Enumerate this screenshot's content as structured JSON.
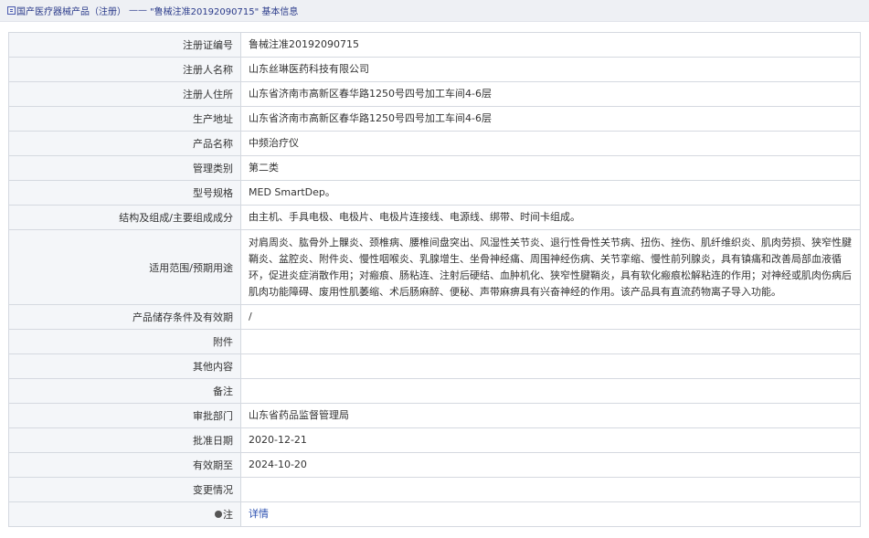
{
  "breadcrumb": {
    "root": "国产医疗器械产品（注册）",
    "separator": "——",
    "current": "\"鲁械注准20192090715\" 基本信息"
  },
  "rows": [
    {
      "label": "注册证编号",
      "value": "鲁械注准20192090715"
    },
    {
      "label": "注册人名称",
      "value": "山东丝琳医药科技有限公司"
    },
    {
      "label": "注册人住所",
      "value": "山东省济南市高新区春华路1250号四号加工车间4-6层"
    },
    {
      "label": "生产地址",
      "value": "山东省济南市高新区春华路1250号四号加工车间4-6层"
    },
    {
      "label": "产品名称",
      "value": "中频治疗仪"
    },
    {
      "label": "管理类别",
      "value": "第二类"
    },
    {
      "label": "型号规格",
      "value": "MED SmartDep。"
    },
    {
      "label": "结构及组成/主要组成成分",
      "value": "由主机、手具电极、电极片、电极片连接线、电源线、绑带、时间卡组成。"
    },
    {
      "label": "适用范围/预期用途",
      "value": "对肩周炎、肱骨外上髁炎、颈椎病、腰椎间盘突出、风湿性关节炎、退行性骨性关节病、扭伤、挫伤、肌纤维织炎、肌肉劳损、狭窄性腱鞘炎、盆腔炎、附件炎、慢性咽喉炎、乳腺增生、坐骨神经痛、周围神经伤病、关节挛缩、慢性前列腺炎，具有镇痛和改善局部血液循环，促进炎症消散作用；对瘢痕、肠粘连、注射后硬结、血肿机化、狭窄性腱鞘炎，具有软化瘢痕松解粘连的作用；对神经或肌肉伤病后肌肉功能障碍、废用性肌萎缩、术后肠麻醉、便秘、声带麻痹具有兴奋神经的作用。该产品具有直流药物离子导入功能。"
    },
    {
      "label": "产品储存条件及有效期",
      "value": "/"
    },
    {
      "label": "附件",
      "value": ""
    },
    {
      "label": "其他内容",
      "value": ""
    },
    {
      "label": "备注",
      "value": ""
    },
    {
      "label": "审批部门",
      "value": "山东省药品监督管理局"
    },
    {
      "label": "批准日期",
      "value": "2020-12-21"
    },
    {
      "label": "有效期至",
      "value": "2024-10-20"
    },
    {
      "label": "变更情况",
      "value": ""
    },
    {
      "label": "注",
      "value": "详情"
    }
  ]
}
